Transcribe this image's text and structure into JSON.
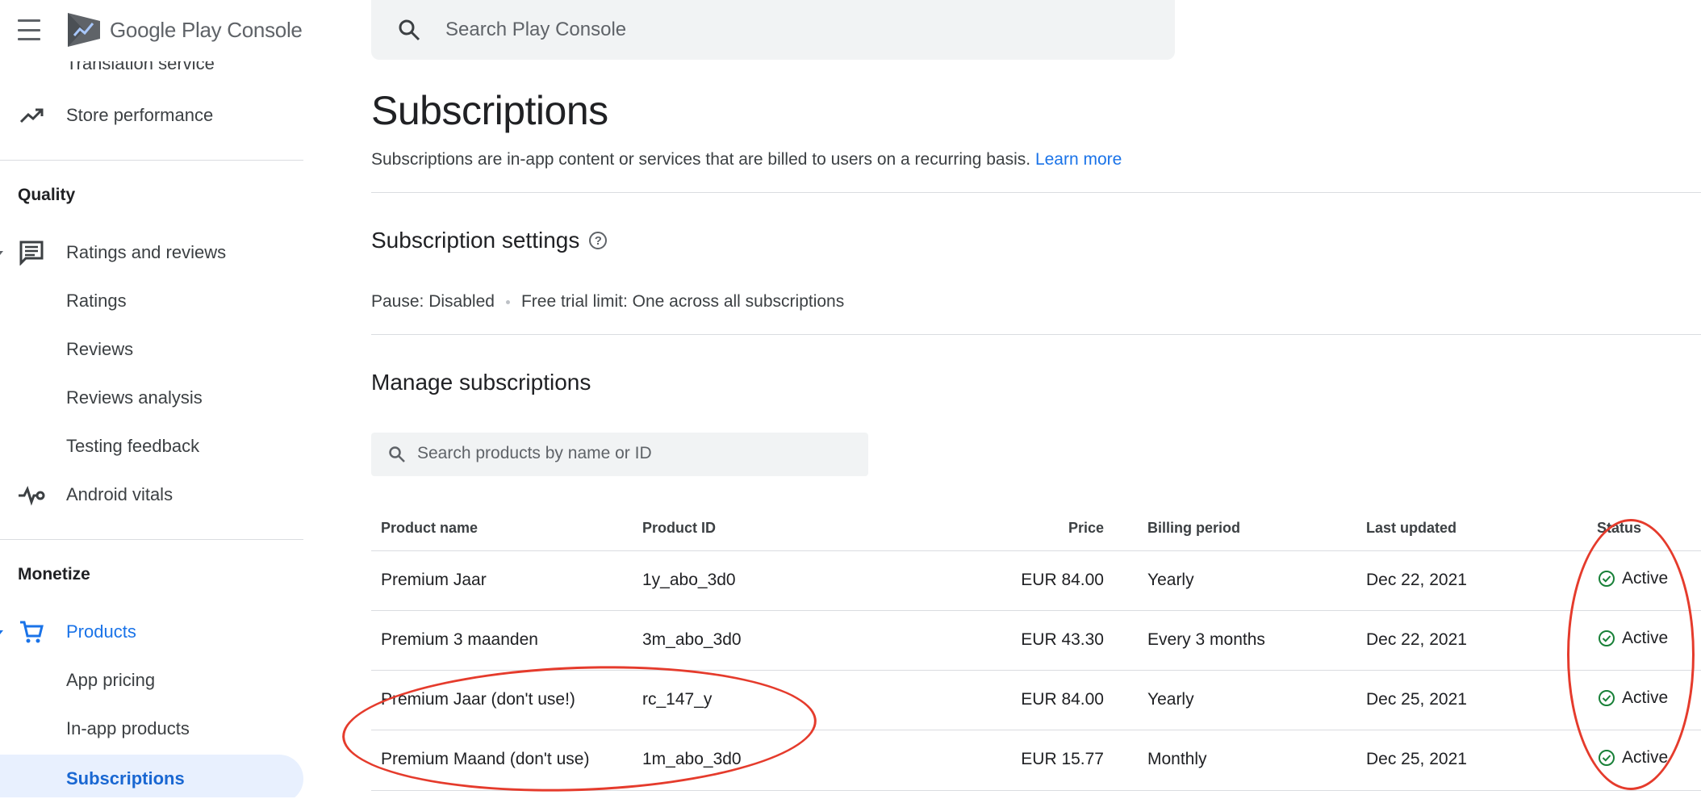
{
  "app": {
    "logo_text_main": "Google Play",
    "logo_text_sub": "Console"
  },
  "colors": {
    "accent": "#1a73e8",
    "active_status": "#188038",
    "annotation": "#e53b2c"
  },
  "sidebar": {
    "cut_item": "Translation service",
    "store_performance": "Store performance",
    "quality_heading": "Quality",
    "ratings_reviews": "Ratings and reviews",
    "ratings": "Ratings",
    "reviews": "Reviews",
    "reviews_analysis": "Reviews analysis",
    "testing_feedback": "Testing feedback",
    "android_vitals": "Android vitals",
    "monetize_heading": "Monetize",
    "products": "Products",
    "app_pricing": "App pricing",
    "inapp_products": "In-app products",
    "subscriptions": "Subscriptions"
  },
  "search": {
    "placeholder": "Search Play Console"
  },
  "page": {
    "title": "Subscriptions",
    "description": "Subscriptions are in-app content or services that are billed to users on a recurring basis.",
    "learn_more": "Learn more"
  },
  "settings": {
    "heading": "Subscription settings",
    "pause": "Pause: Disabled",
    "free_trial": "Free trial limit: One across all subscriptions"
  },
  "manage": {
    "heading": "Manage subscriptions",
    "search_placeholder": "Search products by name or ID"
  },
  "table": {
    "columns": {
      "name": "Product name",
      "id": "Product ID",
      "price": "Price",
      "billing": "Billing period",
      "updated": "Last updated",
      "status": "Status"
    },
    "rows": [
      {
        "name": "Premium Jaar",
        "id": "1y_abo_3d0",
        "price": "EUR 84.00",
        "billing": "Yearly",
        "updated": "Dec 22, 2021",
        "status": "Active"
      },
      {
        "name": "Premium 3 maanden",
        "id": "3m_abo_3d0",
        "price": "EUR 43.30",
        "billing": "Every 3 months",
        "updated": "Dec 22, 2021",
        "status": "Active"
      },
      {
        "name": "Premium Jaar (don't use!)",
        "id": "rc_147_y",
        "price": "EUR 84.00",
        "billing": "Yearly",
        "updated": "Dec 25, 2021",
        "status": "Active"
      },
      {
        "name": "Premium Maand (don't use)",
        "id": "1m_abo_3d0",
        "price": "EUR 15.77",
        "billing": "Monthly",
        "updated": "Dec 25, 2021",
        "status": "Active"
      }
    ]
  }
}
